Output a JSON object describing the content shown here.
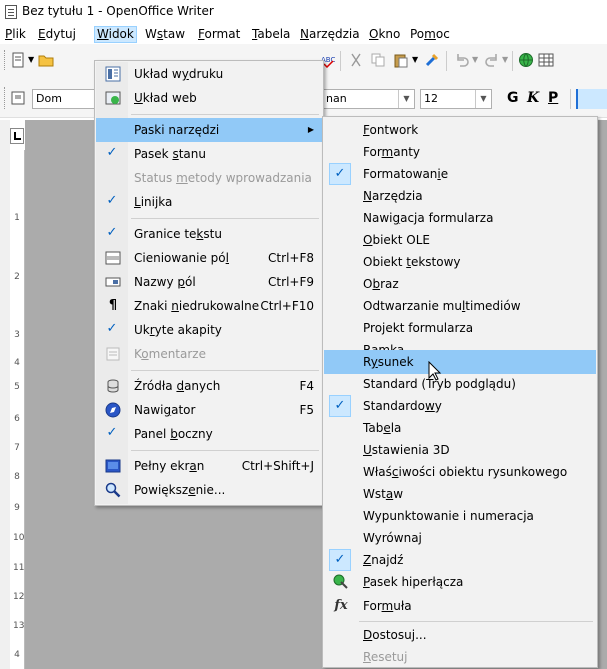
{
  "window": {
    "title": "Bez tytułu 1 - OpenOffice Writer"
  },
  "menubar": [
    {
      "pre": "",
      "u": "P",
      "post": "lik"
    },
    {
      "pre": "",
      "u": "E",
      "post": "dytuj"
    },
    {
      "pre": "",
      "u": "W",
      "post": "idok"
    },
    {
      "pre": "W",
      "u": "s",
      "post": "taw"
    },
    {
      "pre": "",
      "u": "F",
      "post": "ormat"
    },
    {
      "pre": "",
      "u": "T",
      "post": "abela"
    },
    {
      "pre": "",
      "u": "N",
      "post": "arzędzia"
    },
    {
      "pre": "",
      "u": "O",
      "post": "kno"
    },
    {
      "pre": "Po",
      "u": "m",
      "post": "oc"
    }
  ],
  "formatting_bar": {
    "paragraph_style": "Dom",
    "font_name": "nan",
    "font_size": "12",
    "bold": "G",
    "italic": "K",
    "underline": "P"
  },
  "ruler": {
    "marks": [
      "1",
      "2",
      "3",
      "4",
      "5",
      "6",
      "7",
      "8",
      "9",
      "10",
      "11",
      "12",
      "13",
      "4"
    ]
  },
  "view_menu": {
    "items": [
      {
        "pre": "Układ w",
        "u": "y",
        "post": "druku",
        "shortcut": "",
        "icon": "print-layout-icon"
      },
      {
        "pre": "",
        "u": "U",
        "post": "kład web",
        "shortcut": "",
        "icon": "web-layout-icon"
      },
      {
        "pre": "Paski narzędzi",
        "u": "",
        "post": "",
        "shortcut": "",
        "icon": ""
      },
      {
        "pre": "Pasek ",
        "u": "s",
        "post": "tanu",
        "shortcut": "",
        "icon": "check"
      },
      {
        "pre": "Status ",
        "u": "m",
        "post": "etody wprowadzania",
        "shortcut": "",
        "icon": ""
      },
      {
        "pre": "",
        "u": "L",
        "post": "inijka",
        "shortcut": "",
        "icon": "check"
      },
      {
        "pre": "Granice te",
        "u": "k",
        "post": "stu",
        "shortcut": "",
        "icon": "check"
      },
      {
        "pre": "Cieniowanie pó",
        "u": "l",
        "post": "",
        "shortcut": "Ctrl+F8",
        "icon": "field-shading-icon"
      },
      {
        "pre": "Nazwy ",
        "u": "p",
        "post": "ól",
        "shortcut": "Ctrl+F9",
        "icon": "field-names-icon"
      },
      {
        "pre": "Znaki ",
        "u": "n",
        "post": "iedrukowalne",
        "shortcut": "Ctrl+F10",
        "icon": "pilcrow-icon"
      },
      {
        "pre": "Uk",
        "u": "r",
        "post": "yte akapity",
        "shortcut": "",
        "icon": "check"
      },
      {
        "pre": "K",
        "u": "o",
        "post": "mentarze",
        "shortcut": "",
        "icon": "comment-icon"
      },
      {
        "pre": "Źródła ",
        "u": "d",
        "post": "anych",
        "shortcut": "F4",
        "icon": "database-icon"
      },
      {
        "pre": "Nawi",
        "u": "g",
        "post": "ator",
        "shortcut": "F5",
        "icon": "navigator-icon"
      },
      {
        "pre": "Panel ",
        "u": "b",
        "post": "oczny",
        "shortcut": "",
        "icon": "check"
      },
      {
        "pre": "Pełny ekr",
        "u": "a",
        "post": "n",
        "shortcut": "Ctrl+Shift+J",
        "icon": "fullscreen-icon"
      },
      {
        "pre": "Powiększ",
        "u": "e",
        "post": "nie...",
        "shortcut": "",
        "icon": "zoom-icon"
      }
    ]
  },
  "toolbars_submenu": {
    "items": [
      {
        "pre": "",
        "u": "F",
        "post": "ontwork"
      },
      {
        "pre": "For",
        "u": "m",
        "post": "anty"
      },
      {
        "pre": "Formatowan",
        "u": "i",
        "post": "e"
      },
      {
        "pre": "",
        "u": "N",
        "post": "arzędzia"
      },
      {
        "pre": "Nawi",
        "u": "g",
        "post": "acja formularza"
      },
      {
        "pre": "",
        "u": "O",
        "post": "biekt OLE"
      },
      {
        "pre": "Obiekt ",
        "u": "t",
        "post": "ekstowy"
      },
      {
        "pre": "O",
        "u": "b",
        "post": "raz"
      },
      {
        "pre": "Odtwarzanie mu",
        "u": "l",
        "post": "timediów"
      },
      {
        "pre": "Projekt formularza",
        "u": "",
        "post": ""
      },
      {
        "pre": "Ram",
        "u": "k",
        "post": "a"
      },
      {
        "pre": "R",
        "u": "y",
        "post": "sunek"
      },
      {
        "pre": "Standard (Tryb podglądu)",
        "u": "",
        "post": ""
      },
      {
        "pre": "Standardo",
        "u": "w",
        "post": "y"
      },
      {
        "pre": "Tab",
        "u": "e",
        "post": "la"
      },
      {
        "pre": "",
        "u": "U",
        "post": "stawienia 3D"
      },
      {
        "pre": "Właś",
        "u": "c",
        "post": "iwości obiektu rysunkowego"
      },
      {
        "pre": "Wst",
        "u": "a",
        "post": "w"
      },
      {
        "pre": "Wypunktowanie i numeracja",
        "u": "",
        "post": ""
      },
      {
        "pre": "Wyrównaj",
        "u": "",
        "post": ""
      },
      {
        "pre": "",
        "u": "Z",
        "post": "najdź"
      },
      {
        "pre": "",
        "u": "P",
        "post": "asek hiperłącza"
      },
      {
        "pre": "For",
        "u": "m",
        "post": "uła"
      },
      {
        "pre": "",
        "u": "D",
        "post": "ostosuj..."
      },
      {
        "pre": "",
        "u": "R",
        "post": "esetuj"
      }
    ]
  },
  "colors": {
    "highlight": "#91c9f7",
    "check_bg": "#cce8ff",
    "check_border": "#99d1ff",
    "menu_bg": "#f2f2f2",
    "doc_bg": "#ababab"
  }
}
